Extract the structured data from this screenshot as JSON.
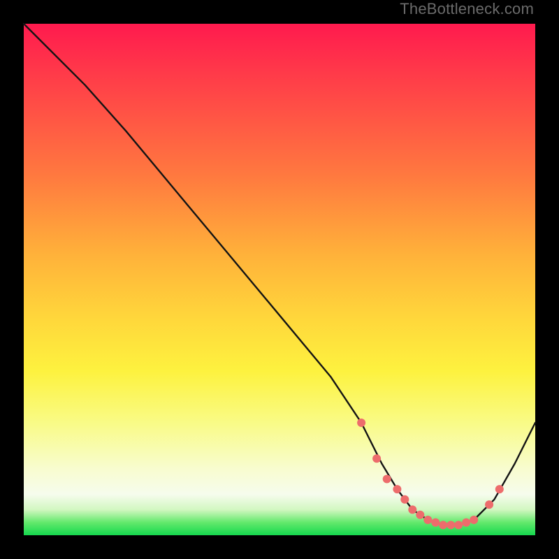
{
  "watermark": "TheBottleneck.com",
  "chart_data": {
    "type": "line",
    "title": "",
    "xlabel": "",
    "ylabel": "",
    "xlim": [
      0,
      100
    ],
    "ylim": [
      0,
      100
    ],
    "series": [
      {
        "name": "bottleneck-curve",
        "x": [
          0,
          5,
          12,
          20,
          30,
          40,
          50,
          60,
          66,
          70,
          73,
          76,
          79,
          82,
          85,
          88,
          92,
          96,
          100
        ],
        "y": [
          100,
          95,
          88,
          79,
          67,
          55,
          43,
          31,
          22,
          14,
          9,
          5,
          3,
          2,
          2,
          3,
          7,
          14,
          22
        ]
      }
    ],
    "markers": {
      "name": "highlight-dots",
      "x": [
        66,
        69,
        71,
        73,
        74.5,
        76,
        77.5,
        79,
        80.5,
        82,
        83.5,
        85,
        86.5,
        88,
        91,
        93
      ],
      "y": [
        22,
        15,
        11,
        9,
        7,
        5,
        4,
        3,
        2.5,
        2,
        2,
        2,
        2.5,
        3,
        6,
        9
      ]
    },
    "background_gradient": {
      "stops": [
        {
          "pos": 0,
          "color": "#ff1a4e"
        },
        {
          "pos": 0.45,
          "color": "#ffb13a"
        },
        {
          "pos": 0.78,
          "color": "#f9fb86"
        },
        {
          "pos": 0.92,
          "color": "#f6fced"
        },
        {
          "pos": 1.0,
          "color": "#15d84e"
        }
      ]
    }
  }
}
